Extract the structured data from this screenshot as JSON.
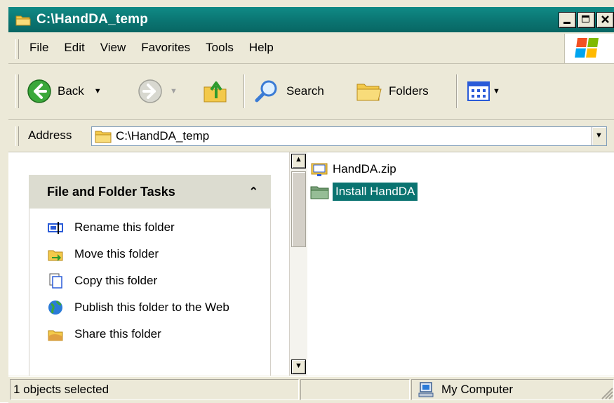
{
  "window": {
    "title": "C:\\HandDA_temp"
  },
  "menu": {
    "items": [
      "File",
      "Edit",
      "View",
      "Favorites",
      "Tools",
      "Help"
    ]
  },
  "toolbar": {
    "back_label": "Back",
    "search_label": "Search",
    "folders_label": "Folders"
  },
  "address": {
    "label": "Address",
    "value": "C:\\HandDA_temp"
  },
  "tasks": {
    "title": "File and Folder Tasks",
    "items": [
      {
        "label": "Rename this folder",
        "icon": "rename-icon"
      },
      {
        "label": "Move this folder",
        "icon": "move-icon"
      },
      {
        "label": "Copy this folder",
        "icon": "copy-icon"
      },
      {
        "label": "Publish this folder to the Web",
        "icon": "publish-web-icon"
      },
      {
        "label": "Share this folder",
        "icon": "share-icon"
      }
    ]
  },
  "files": [
    {
      "name": "HandDA.zip",
      "icon": "zip-icon",
      "selected": false
    },
    {
      "name": "Install HandDA",
      "icon": "folder-icon",
      "selected": true
    }
  ],
  "status": {
    "left": "1 objects selected",
    "zone": "My Computer"
  },
  "colors": {
    "accent": "#0a7370",
    "face": "#ece9d8"
  }
}
